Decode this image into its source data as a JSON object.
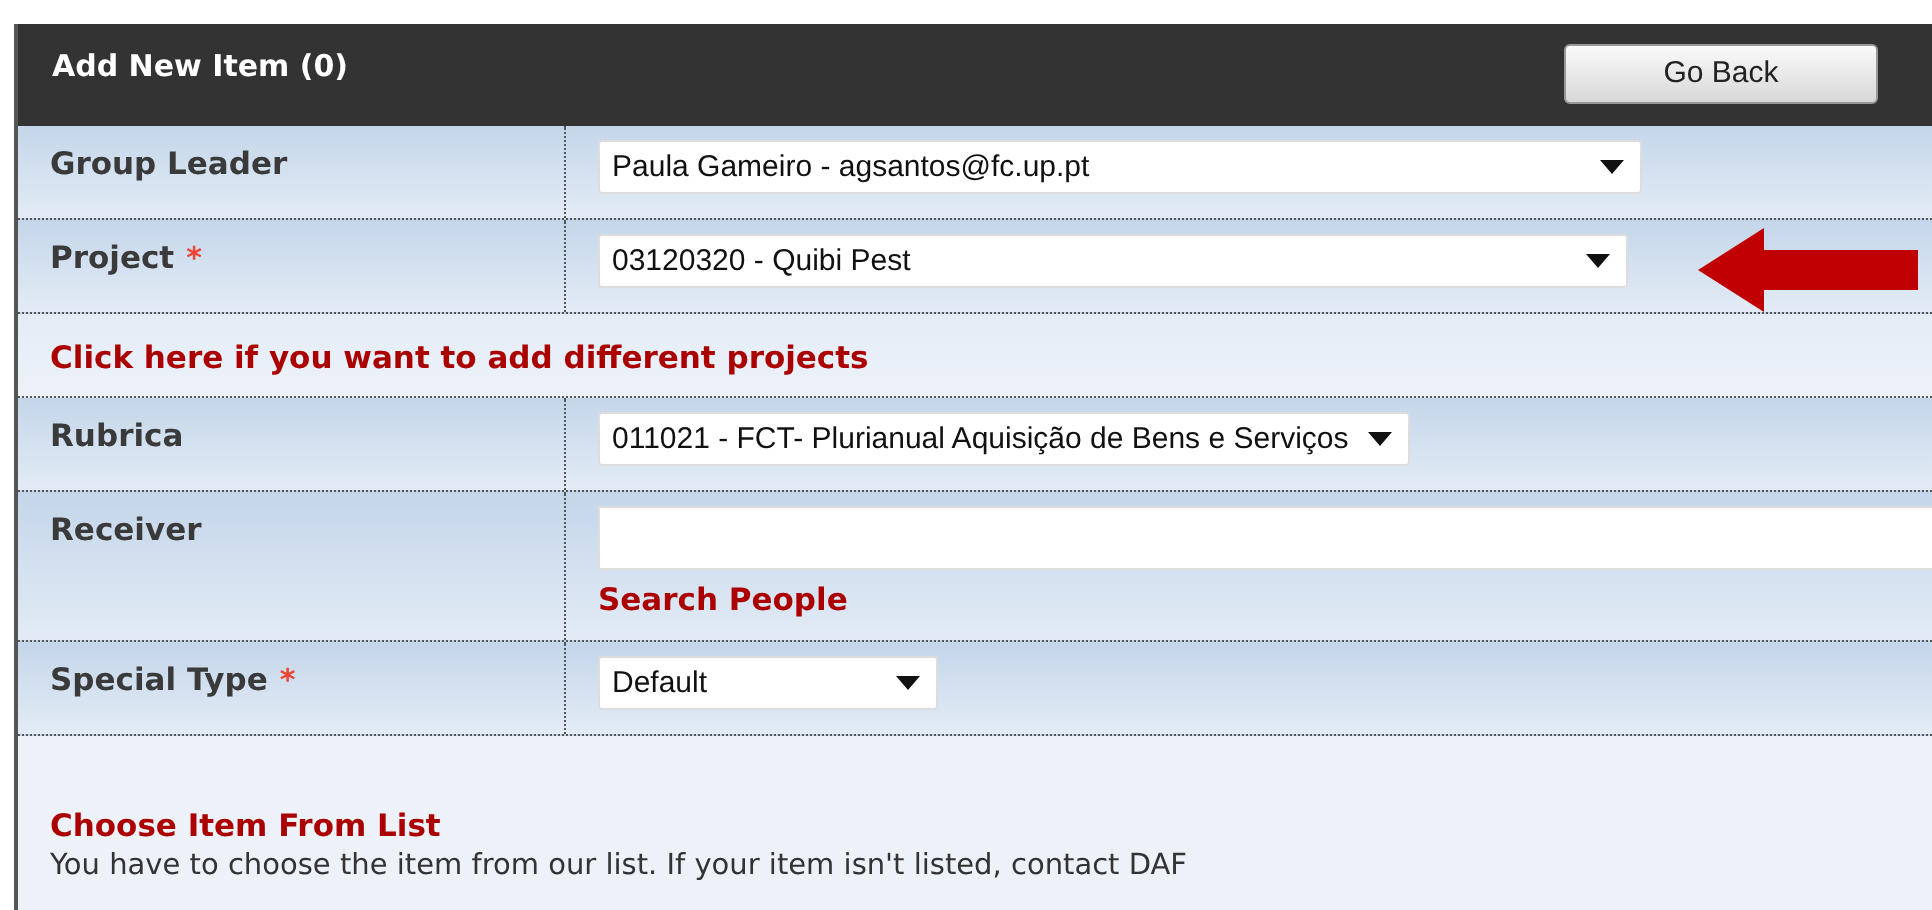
{
  "header": {
    "title": "Add New Item (0)",
    "button": "Go Back"
  },
  "rows": [
    {
      "kind": "select",
      "label": "Group Leader",
      "value": "Paula Gameiro - agsantos@fc.up.pt"
    },
    {
      "kind": "select",
      "label": "Project",
      "required_mark": "*",
      "value": "03120320 - Quibi Pest",
      "pointer": {
        "kind": "arrow"
      }
    },
    {
      "kind": "link",
      "label": "Click here if you want to add different projects"
    },
    {
      "kind": "select",
      "label": "Rubrica",
      "value": "011021 - FCT- Plurianual Aquisição de Bens e Serviços"
    },
    {
      "kind": "input",
      "label": "Receiver",
      "link": "Search People"
    },
    {
      "kind": "select",
      "label": "Special Type",
      "required_mark": "*",
      "value": "Default"
    }
  ],
  "section": {
    "title": "Choose Item From List",
    "text": "You have to choose the item from our list. If your item isn't listed, contact DAF"
  }
}
